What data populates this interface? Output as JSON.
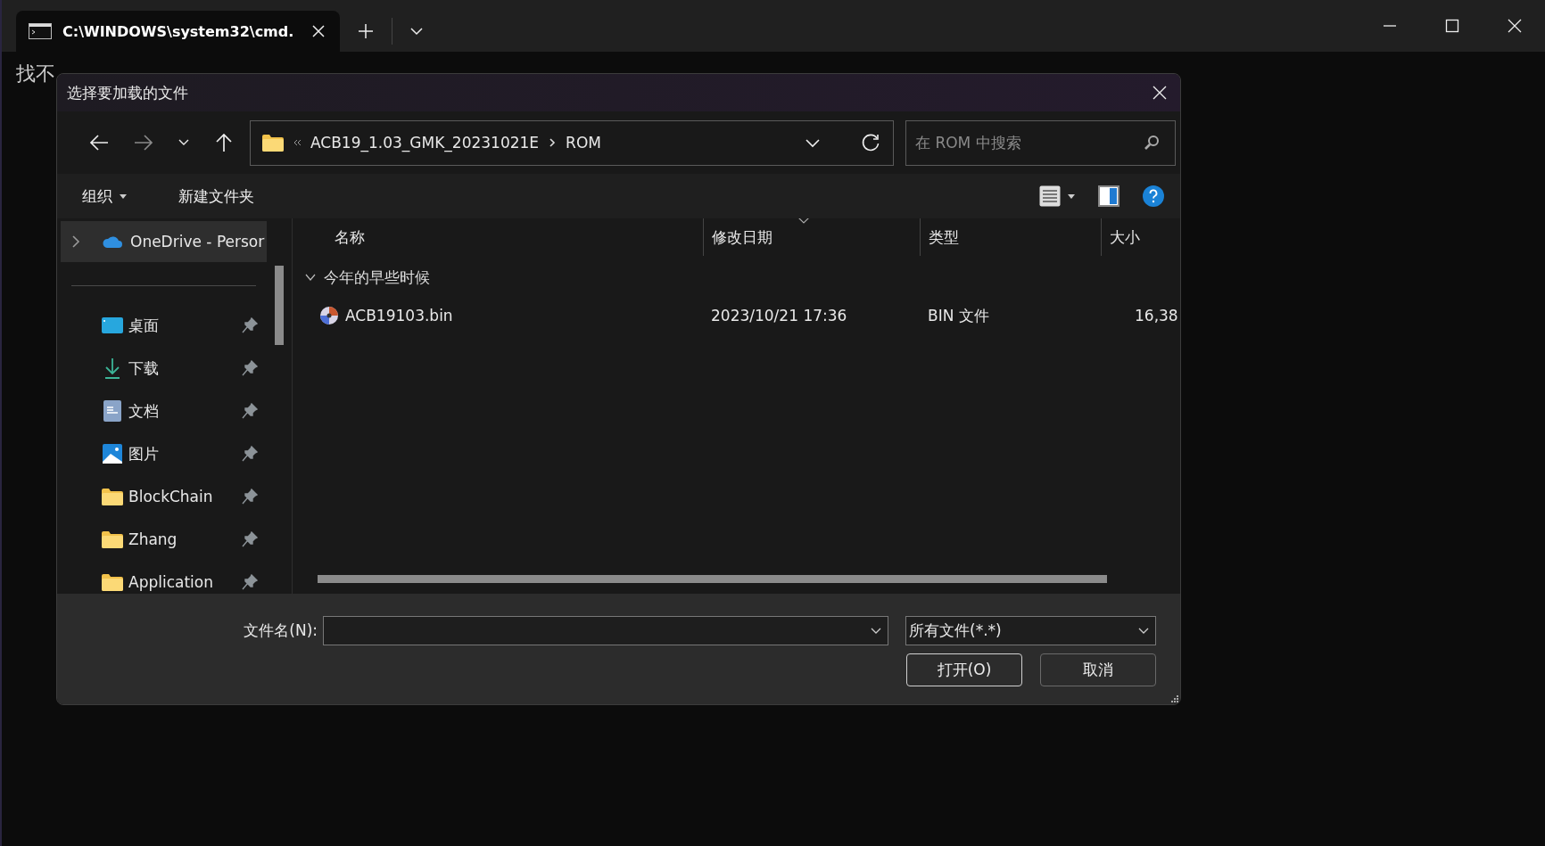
{
  "terminal": {
    "tab": {
      "title": "C:\\WINDOWS\\system32\\cmd.",
      "selected": true
    },
    "output": "找不"
  },
  "dialog": {
    "title": "选择要加载的文件",
    "address": {
      "path": [
        "ACB19_1.03_GMK_20231021E",
        "ROM"
      ]
    },
    "search": {
      "placeholder": "在 ROM 中搜索"
    },
    "toolbar": {
      "organize": "组织",
      "new_folder": "新建文件夹"
    },
    "nav": [
      {
        "label": "OneDrive - Persor",
        "kind": "cloud",
        "selected": true,
        "pinned": false,
        "expanded": false
      },
      {
        "label": "桌面",
        "kind": "desktop",
        "selected": false,
        "pinned": true
      },
      {
        "label": "下载",
        "kind": "download",
        "selected": false,
        "pinned": true
      },
      {
        "label": "文档",
        "kind": "document",
        "selected": false,
        "pinned": true
      },
      {
        "label": "图片",
        "kind": "picture",
        "selected": false,
        "pinned": true
      },
      {
        "label": "BlockChain",
        "kind": "folder",
        "selected": false,
        "pinned": true
      },
      {
        "label": "Zhang",
        "kind": "folder",
        "selected": false,
        "pinned": true
      },
      {
        "label": "Application",
        "kind": "folder",
        "selected": false,
        "pinned": true
      }
    ],
    "columns": [
      {
        "label": "名称",
        "sorted": false
      },
      {
        "label": "修改日期",
        "sorted": true
      },
      {
        "label": "类型",
        "sorted": false
      },
      {
        "label": "大小",
        "sorted": false
      }
    ],
    "groups": [
      {
        "label": "今年的早些时候",
        "expanded": true,
        "rows": [
          {
            "name": "ACB19103.bin",
            "date": "2023/10/21 17:36",
            "type": "BIN 文件",
            "size": "16,38",
            "selected": false
          }
        ]
      }
    ],
    "file_name_label": "文件名(N):",
    "file_type": "所有文件(*.*)",
    "buttons": [
      {
        "label": "打开(O)",
        "default": true
      },
      {
        "label": "取消",
        "default": false
      }
    ]
  }
}
